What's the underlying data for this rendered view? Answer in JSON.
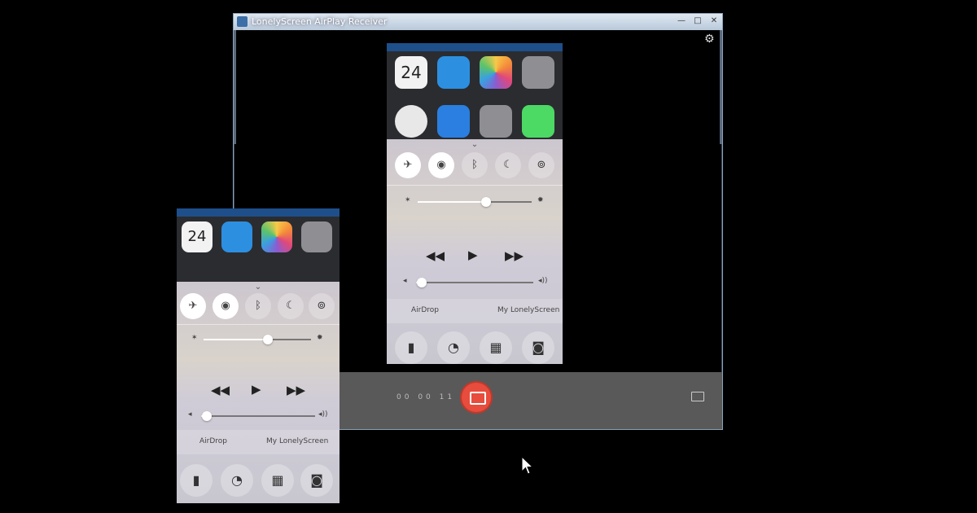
{
  "window": {
    "title": "LonelyScreen AirPlay Receiver",
    "minimize": "—",
    "maximize": "□",
    "close": "✕"
  },
  "icons": {
    "settings": "⚙",
    "collapse": "⌄",
    "airplane": "✈",
    "wifi": "◉",
    "bluetooth": "ᛒ",
    "moon": "☾",
    "rotation_lock": "⊚",
    "rewind": "◀◀",
    "play": "▶",
    "fast_forward": "▶▶",
    "flashlight": "▮",
    "timer": "◔",
    "calculator": "▦",
    "camera": "◙",
    "cursor": "cursor-arrow"
  },
  "recorder": {
    "timer": "00 00 11"
  },
  "control_center": {
    "airdrop_label": "AirDrop",
    "airplay_label": "My LonelyScreen",
    "brightness": 0.6,
    "volume": 0.05,
    "toggles": [
      {
        "name": "airplane-mode",
        "on": true
      },
      {
        "name": "wifi",
        "on": true
      },
      {
        "name": "bluetooth",
        "on": false
      },
      {
        "name": "do-not-disturb",
        "on": false
      },
      {
        "name": "rotation-lock",
        "on": false
      }
    ]
  },
  "home_icons": {
    "calendar_day": "24"
  },
  "colors": {
    "status_bar": "#1e4f8a",
    "record_button": "#e74c3c",
    "toolbar": "#595959",
    "window_border": "#8aa0b8"
  }
}
